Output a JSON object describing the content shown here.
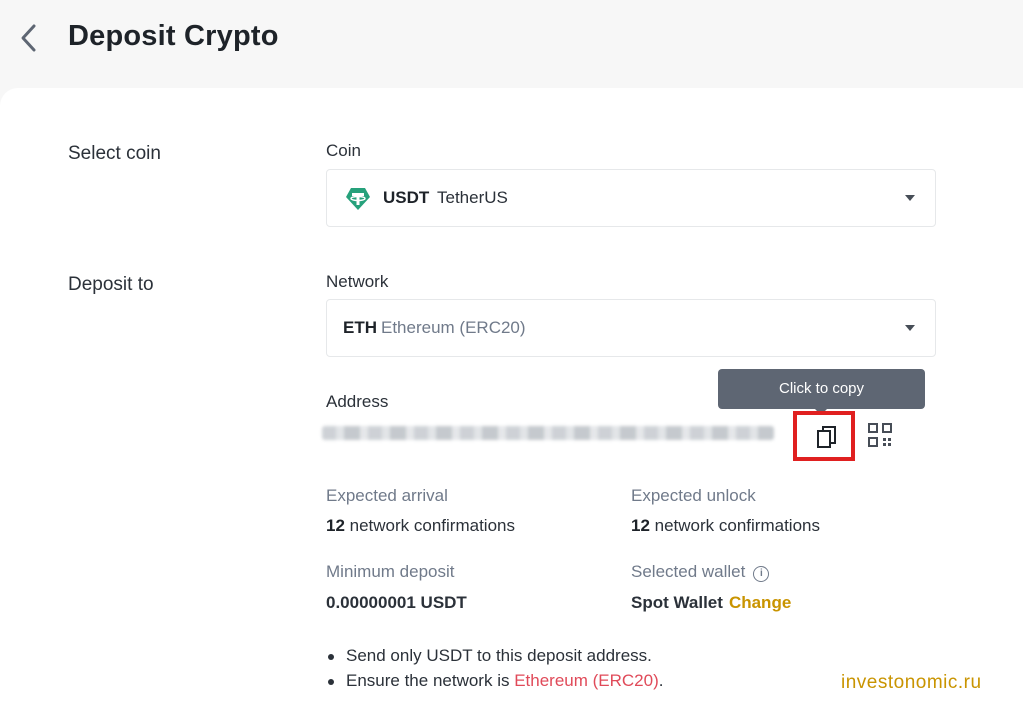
{
  "header": {
    "title": "Deposit Crypto"
  },
  "coin_section": {
    "side_label": "Select coin",
    "field_label": "Coin",
    "selected_symbol": "USDT",
    "selected_name": "TetherUS"
  },
  "network_section": {
    "side_label": "Deposit to",
    "field_label": "Network",
    "selected_symbol": "ETH",
    "selected_name": "Ethereum (ERC20)"
  },
  "address": {
    "label": "Address",
    "tooltip": "Click to copy"
  },
  "info": {
    "arrival_label": "Expected arrival",
    "arrival_count": "12",
    "arrival_text": " network confirmations",
    "unlock_label": "Expected unlock",
    "unlock_count": "12",
    "unlock_text": " network confirmations",
    "min_label": "Minimum deposit",
    "min_value": "0.00000001 USDT",
    "wallet_label": "Selected wallet",
    "wallet_value": "Spot Wallet",
    "change_label": "Change"
  },
  "notes": {
    "line1_a": "Send only ",
    "line1_b": "USDT",
    "line1_c": " to this deposit address.",
    "line2_a": "Ensure the network is ",
    "line2_b": "Ethereum (ERC20)",
    "line2_c": "."
  },
  "watermark": "investonomic.ru",
  "colors": {
    "accent": "#c99400",
    "highlight_box": "#e02020",
    "tether": "#26a17b",
    "warning": "#e04a59"
  }
}
